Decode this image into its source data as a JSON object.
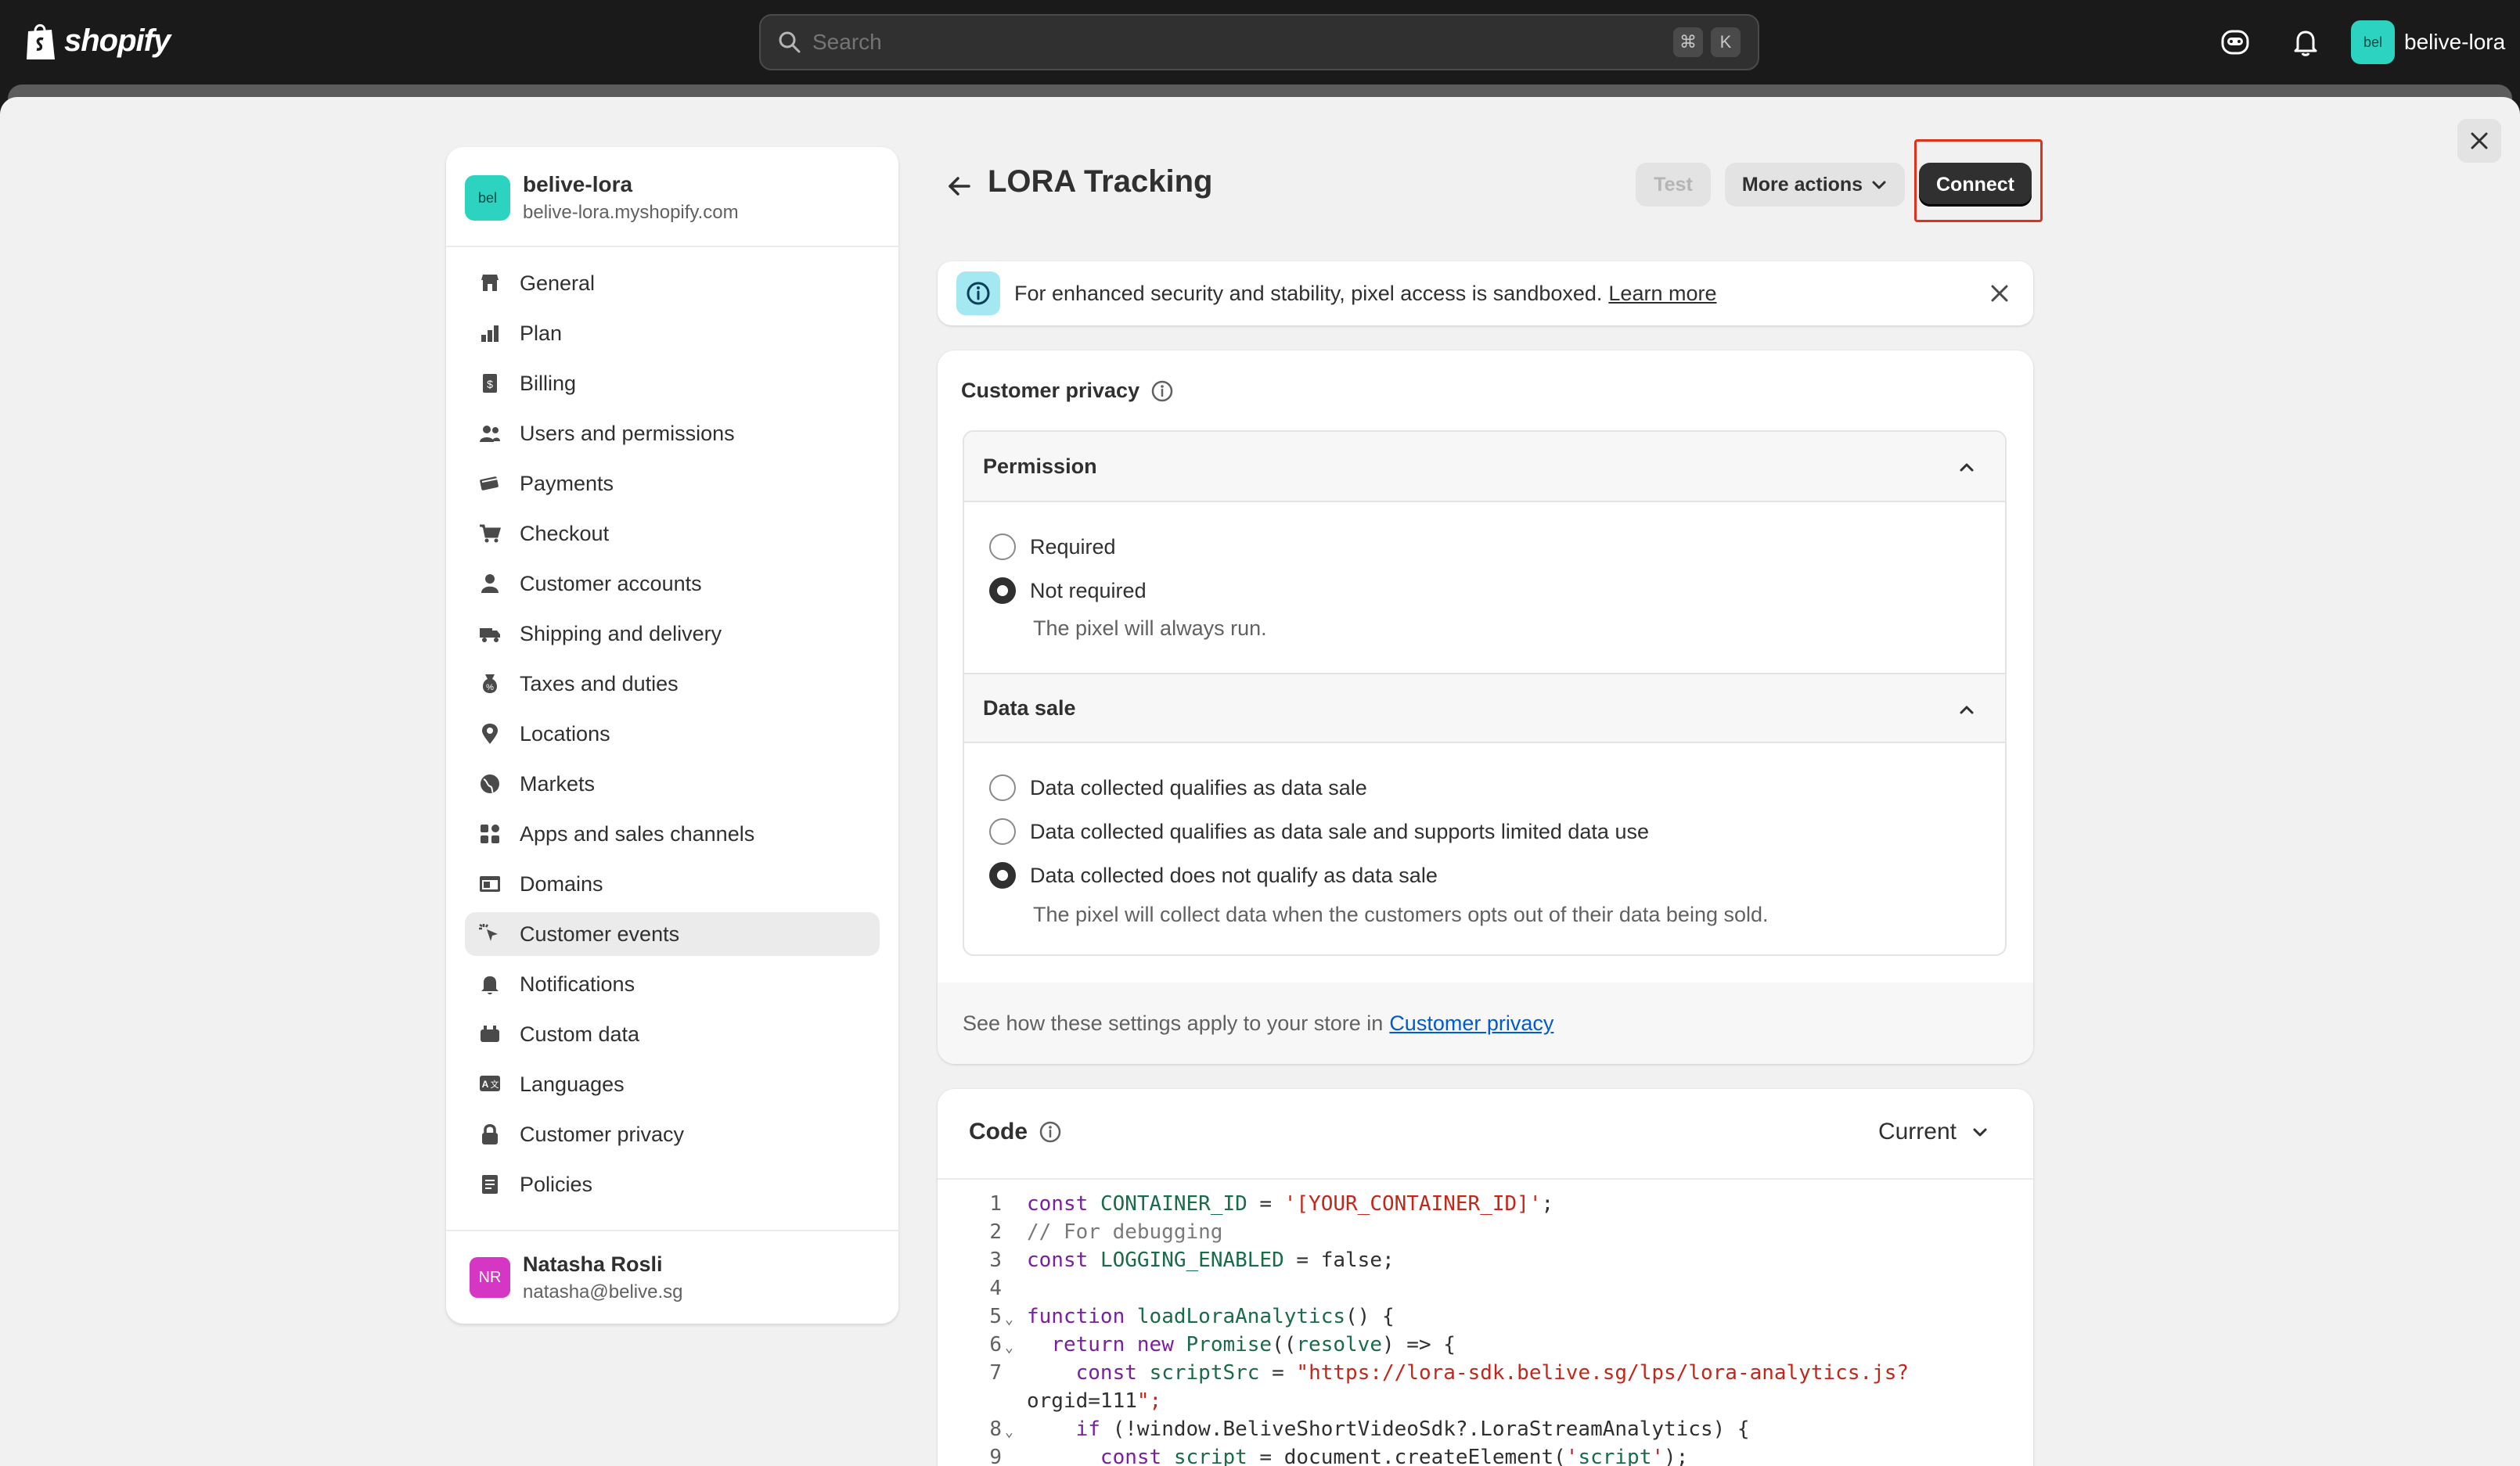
{
  "topbar": {
    "brand": "shopify",
    "search_placeholder": "Search",
    "shortcut_keys": [
      "⌘",
      "K"
    ],
    "store_avatar": "bel",
    "store_name": "belive-lora"
  },
  "sidebar": {
    "store_avatar": "bel",
    "store_title": "belive-lora",
    "store_domain": "belive-lora.myshopify.com",
    "items": [
      {
        "label": "General",
        "icon": "store-icon"
      },
      {
        "label": "Plan",
        "icon": "plan-icon"
      },
      {
        "label": "Billing",
        "icon": "billing-icon"
      },
      {
        "label": "Users and permissions",
        "icon": "users-icon"
      },
      {
        "label": "Payments",
        "icon": "payments-icon"
      },
      {
        "label": "Checkout",
        "icon": "cart-icon"
      },
      {
        "label": "Customer accounts",
        "icon": "person-icon"
      },
      {
        "label": "Shipping and delivery",
        "icon": "truck-icon"
      },
      {
        "label": "Taxes and duties",
        "icon": "tax-icon"
      },
      {
        "label": "Locations",
        "icon": "location-icon"
      },
      {
        "label": "Markets",
        "icon": "globe-icon"
      },
      {
        "label": "Apps and sales channels",
        "icon": "apps-icon"
      },
      {
        "label": "Domains",
        "icon": "domain-icon"
      },
      {
        "label": "Customer events",
        "icon": "cursor-icon",
        "active": true
      },
      {
        "label": "Notifications",
        "icon": "bell-icon"
      },
      {
        "label": "Custom data",
        "icon": "data-icon"
      },
      {
        "label": "Languages",
        "icon": "language-icon"
      },
      {
        "label": "Customer privacy",
        "icon": "lock-icon"
      },
      {
        "label": "Policies",
        "icon": "policy-icon"
      }
    ],
    "user": {
      "initials": "NR",
      "name": "Natasha Rosli",
      "email": "natasha@belive.sg"
    }
  },
  "header": {
    "title": "LORA Tracking",
    "test_label": "Test",
    "more_actions_label": "More actions",
    "connect_label": "Connect"
  },
  "banner": {
    "text": "For enhanced security and stability, pixel access is sandboxed.",
    "link": "Learn more"
  },
  "privacy": {
    "title": "Customer privacy",
    "permission": {
      "heading": "Permission",
      "options": [
        "Required",
        "Not required"
      ],
      "selected": "Not required",
      "help": "The pixel will always run."
    },
    "data_sale": {
      "heading": "Data sale",
      "options": [
        "Data collected qualifies as data sale",
        "Data collected qualifies as data sale and supports limited data use",
        "Data collected does not qualify as data sale"
      ],
      "selected": "Data collected does not qualify as data sale",
      "help": "The pixel will collect data when the customers opts out of their data being sold."
    },
    "footer_text": "See how these settings apply to your store in",
    "footer_link": "Customer privacy"
  },
  "code": {
    "title": "Code",
    "version": "Current",
    "line_numbers": [
      "1",
      "2",
      "3",
      "4",
      "5",
      "6",
      "7",
      "",
      "8",
      "9"
    ],
    "lines": [
      "const CONTAINER_ID = '[YOUR_CONTAINER_ID]';",
      "// For debugging",
      "const LOGGING_ENABLED = false;",
      "",
      "function loadLoraAnalytics() {",
      "  return new Promise((resolve) => {",
      "    const scriptSrc = \"https://lora-sdk.belive.sg/lps/lora-analytics.js?",
      "orgid=111\";",
      "    if (!window.BeliveShortVideoSdk?.LoraStreamAnalytics) {",
      "      const script = document.createElement('script');"
    ]
  },
  "colors": {
    "accent_connect": "#303030",
    "highlight_outline": "#e0301e",
    "info_badge": "#a4e8f2",
    "store_avatar": "#2cd3c0",
    "user_avatar": "#d636c4",
    "link": "#005bd3"
  }
}
